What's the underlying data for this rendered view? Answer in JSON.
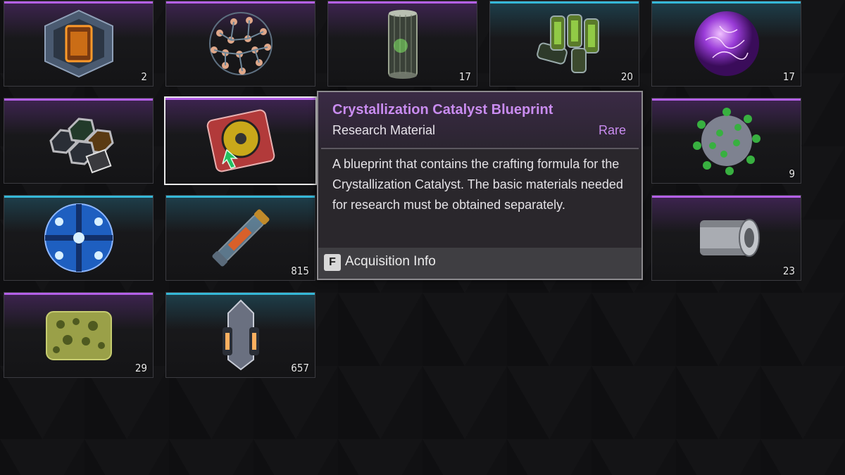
{
  "inventory": [
    {
      "row": 0,
      "col": 0,
      "rarity": "epic",
      "quantity": "2",
      "icon": "hexagonal-capsule-icon"
    },
    {
      "row": 0,
      "col": 1,
      "rarity": "epic",
      "quantity": "",
      "icon": "molecule-sphere-icon"
    },
    {
      "row": 0,
      "col": 2,
      "rarity": "epic",
      "quantity": "17",
      "icon": "cylinder-canister-icon"
    },
    {
      "row": 0,
      "col": 3,
      "rarity": "rare",
      "quantity": "20",
      "icon": "green-vials-icon"
    },
    {
      "row": 0,
      "col": 4,
      "rarity": "rare",
      "quantity": "17",
      "icon": "plasma-orb-icon"
    },
    {
      "row": 1,
      "col": 0,
      "rarity": "epic",
      "quantity": "",
      "icon": "hex-tray-icon"
    },
    {
      "row": 1,
      "col": 1,
      "rarity": "epic",
      "quantity": "",
      "icon": "blueprint-disk-icon",
      "selected": true
    },
    {
      "row": 1,
      "col": 4,
      "rarity": "epic",
      "quantity": "9",
      "icon": "virus-sphere-icon"
    },
    {
      "row": 2,
      "col": 0,
      "rarity": "rare",
      "quantity": "",
      "icon": "blue-core-sphere-icon"
    },
    {
      "row": 2,
      "col": 1,
      "rarity": "rare",
      "quantity": "815",
      "icon": "sample-tube-icon"
    },
    {
      "row": 2,
      "col": 4,
      "rarity": "epic",
      "quantity": "23",
      "icon": "metal-cylinder-icon"
    },
    {
      "row": 3,
      "col": 0,
      "rarity": "epic",
      "quantity": "29",
      "icon": "mossy-block-icon"
    },
    {
      "row": 3,
      "col": 1,
      "rarity": "rare",
      "quantity": "657",
      "icon": "thruster-module-icon"
    }
  ],
  "tooltip": {
    "title": "Crystallization Catalyst Blueprint",
    "category": "Research Material",
    "rarity": "Rare",
    "description": "A blueprint that contains the crafting formula for the Crystallization Catalyst. The basic materials needed for research must be obtained separately.",
    "action_key": "F",
    "action_label": "Acquisition Info"
  },
  "colors": {
    "epic_accent": "#b460e8",
    "rare_accent": "#35b8d8",
    "tooltip_title": "#c98cf0"
  }
}
